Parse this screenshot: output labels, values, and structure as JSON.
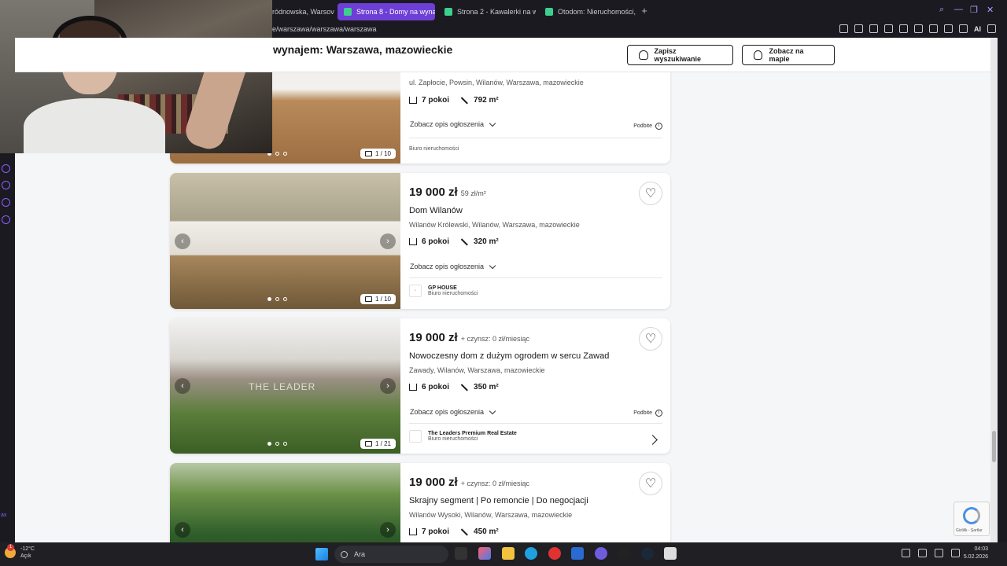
{
  "browser": {
    "tabs": [
      {
        "label": "ródnowska, Warsov",
        "active": false
      },
      {
        "label": "Strona 8 - Domy na wynaj",
        "active": true
      },
      {
        "label": "Strona 2 - Kawalerki na w",
        "active": false
      },
      {
        "label": "Otodom: Nieruchomości, I",
        "active": false
      }
    ],
    "new_tab": "+",
    "url": "e/warszawa/warszawa/warszawa",
    "ai_label": "AI"
  },
  "sidebar": {
    "bottom_text": "ax"
  },
  "header": {
    "heading": "wynajem: Warszawa, mazowieckie",
    "save_search_label": "Zapisz wyszukiwanie",
    "show_map_label": "Zobacz na mapie"
  },
  "listings": [
    {
      "price": "",
      "price_sub": "",
      "title": "",
      "location": "ul. Zapłocie, Powsin, Wilanów, Warszawa, mazowieckie",
      "rooms": "7 pokoi",
      "area": "792 m²",
      "desc_link": "Zobacz opis ogłoszenia",
      "promoted": "Podbite",
      "agency_name": "",
      "agency_type": "Biuro nieruchomości",
      "photo_count": "1 / 10"
    },
    {
      "price": "19 000 zł",
      "price_sub": "59 zł/m²",
      "title": "Dom Wilanów",
      "location": "Wilanów Królewski, Wilanów, Warszawa, mazowieckie",
      "rooms": "6 pokoi",
      "area": "320 m²",
      "desc_link": "Zobacz opis ogłoszenia",
      "promoted": "",
      "agency_name": "GP HOUSE",
      "agency_type": "Biuro nieruchomości",
      "photo_count": "1 / 10"
    },
    {
      "price": "19 000 zł",
      "price_sub": "+ czynsz: 0 zł/miesiąc",
      "title": "Nowoczesny dom z dużym ogrodem w sercu Zawad",
      "location": "Zawady, Wilanów, Warszawa, mazowieckie",
      "rooms": "6 pokoi",
      "area": "350 m²",
      "desc_link": "Zobacz opis ogłoszenia",
      "promoted": "Podbite",
      "agency_name": "The Leaders Premium Real Estate",
      "agency_type": "Biuro nieruchomości",
      "photo_count": "1 / 21",
      "watermark": "THE LEADER"
    },
    {
      "price": "19 000 zł",
      "price_sub": "+ czynsz: 0 zł/miesiąc",
      "title": "Skrajny segment | Po remoncie | Do negocjacji",
      "location": "Wilanów Wysoki, Wilanów, Warszawa, mazowieckie",
      "rooms": "7 pokoi",
      "area": "450 m²"
    }
  ],
  "recaptcha": {
    "text": "Gizlilik - Şartlar"
  },
  "taskbar": {
    "weather_temp": "-12°C",
    "weather_desc": "Açık",
    "weather_badge": "1",
    "search_placeholder": "Ara",
    "time": "04:03",
    "date": "5.02.2026"
  },
  "colors": {
    "accent": "#6d3fd6",
    "page_bg": "#f5f6f8"
  }
}
